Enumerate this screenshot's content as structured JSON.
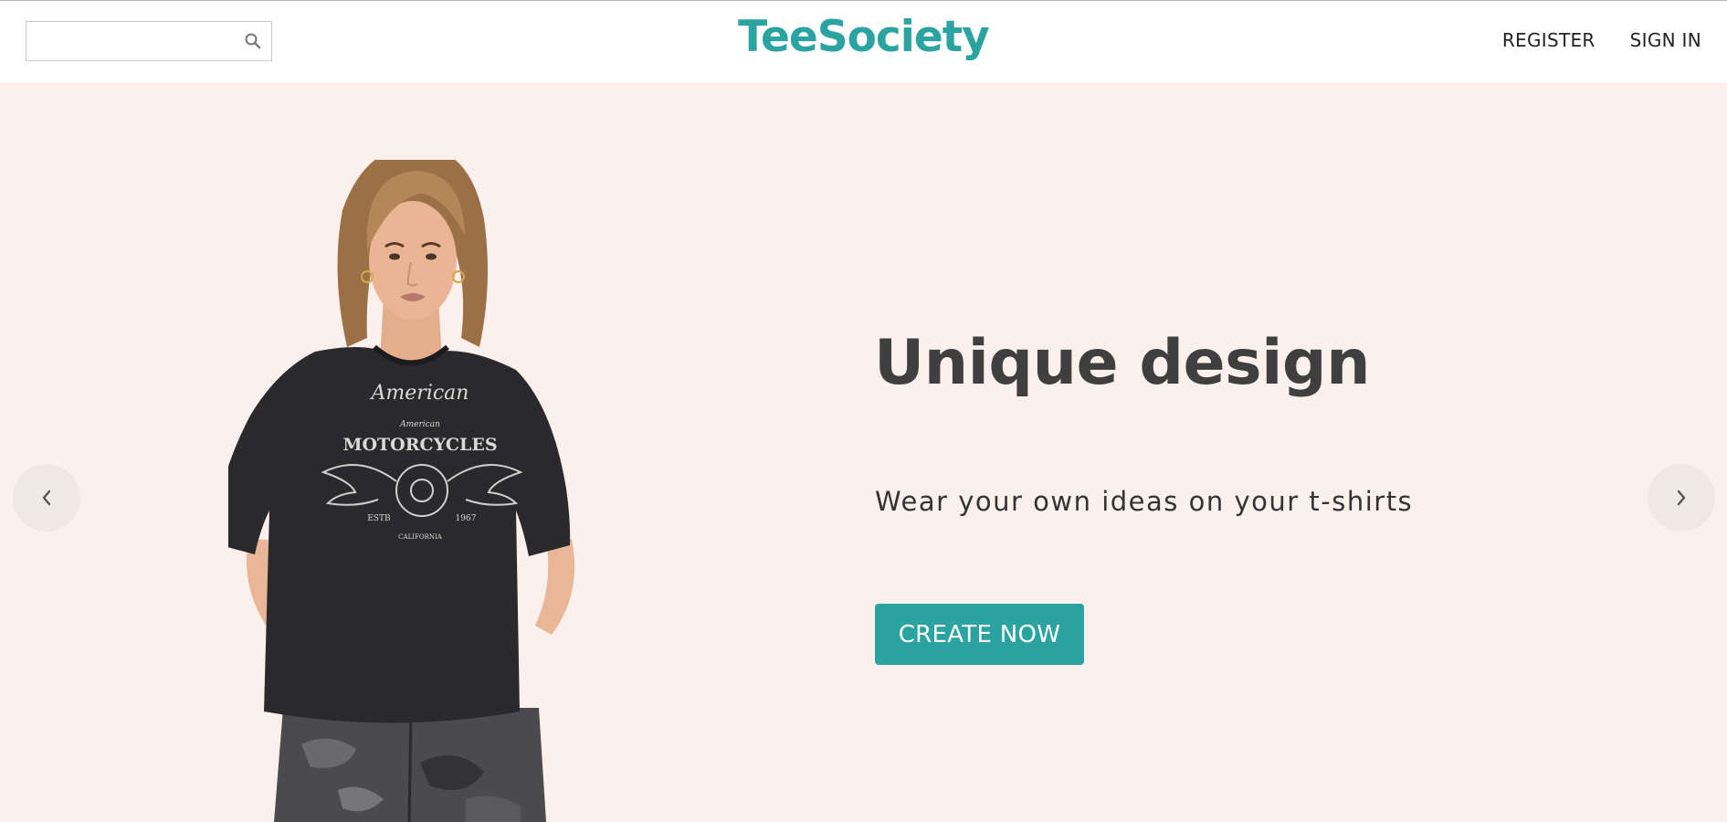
{
  "header": {
    "search": {
      "placeholder": "",
      "value": "",
      "icon": "search-icon"
    },
    "logo": "TeeSociety",
    "nav": [
      {
        "label": "REGISTER"
      },
      {
        "label": "SIGN IN"
      }
    ]
  },
  "hero": {
    "title": "Unique design",
    "subtitle": "Wear your own ideas on your t-shirts",
    "cta_label": "CREATE NOW",
    "image": {
      "shirt_text_line1": "American",
      "shirt_text_line2": "American",
      "shirt_text_line3": "MOTORCYCLES",
      "shirt_text_estb": "ESTB",
      "shirt_text_year": "1967",
      "shirt_text_state": "CALIFORNIA"
    },
    "prev_icon": "chevron-left-icon",
    "next_icon": "chevron-right-icon"
  },
  "colors": {
    "brand": "#2ba3a1",
    "hero_background": "#fbf0ec",
    "title_text": "#3f3f3f",
    "shirt": "#2a2a2c"
  }
}
